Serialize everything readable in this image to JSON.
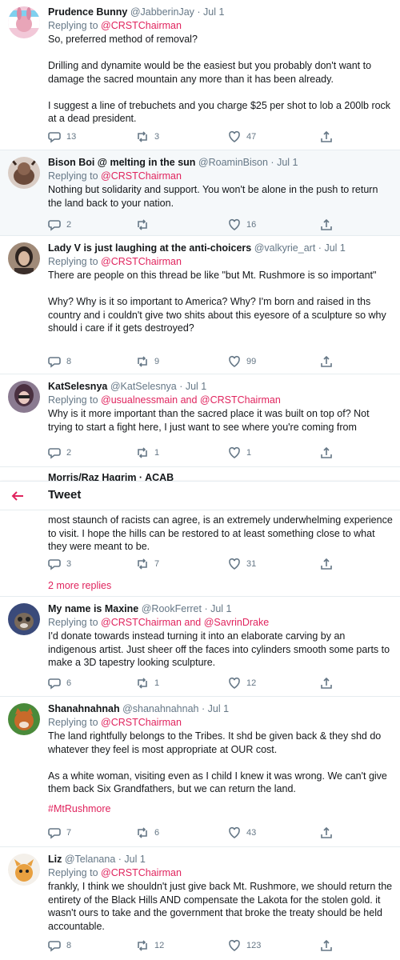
{
  "colors": {
    "accent": "#e0245e",
    "secondary_text": "#657786",
    "divider": "#e6ecf0"
  },
  "tweets": [
    {
      "name": "Prudence Bunny",
      "handle": "@JabberinJay",
      "dot": "·",
      "date": "Jul 1",
      "replying_prefix": "Replying to",
      "mentions": "@CRSTChairman",
      "text": "So, preferred method of removal?\n\nDrilling and dynamite would be the easiest but you probably don't want to damage the sacred mountain any more than it has been already.\n\nI suggest a line of trebuchets and you charge $25 per shot to lob a 200lb rock at a dead president.",
      "replies": "13",
      "retweets": "3",
      "likes": "47"
    },
    {
      "name": "Bison Boi @ melting in the sun",
      "handle": "@RoaminBison",
      "dot": "·",
      "date": "Jul 1",
      "replying_prefix": "Replying to",
      "mentions": "@CRSTChairman",
      "text": "Nothing but solidarity and support. You won't be alone in the push to return the land back to your nation.",
      "replies": "2",
      "retweets": "",
      "likes": "16"
    },
    {
      "name": "Lady V is just laughing at the anti-choicers",
      "handle": "@valkyrie_art",
      "dot": "·",
      "date": "Jul 1",
      "replying_prefix": "Replying to",
      "mentions": "@CRSTChairman",
      "text": "There are people on this thread be like \"but Mt. Rushmore is so important\"\n\nWhy? Why is it so important to America? Why?  I'm born and raised in ths country and i couldn't give two shits about this eyesore of a sculpture so why should i care if it gets destroyed?",
      "replies": "8",
      "retweets": "9",
      "likes": "99"
    },
    {
      "name": "KatSelesnya",
      "handle": "@KatSelesnya",
      "dot": "·",
      "date": "Jul 1",
      "replying_prefix": "Replying to",
      "mentions": "@usualnessmain and @CRSTChairman",
      "text": "Why is it more important than the sacred place it was built on top of? Not trying to start a fight here, I just want to see where you're coming from",
      "replies": "2",
      "retweets": "1",
      "likes": "1"
    },
    {
      "text": "most staunch of racists can agree, is an extremely underwhelming experience to visit. I hope the hills can be restored to at least something close to what they were meant to be.",
      "replies": "3",
      "retweets": "7",
      "likes": "31",
      "more_replies": "2 more replies"
    },
    {
      "name": "My name is Maxine",
      "handle": "@RookFerret",
      "dot": "·",
      "date": "Jul 1",
      "replying_prefix": "Replying to",
      "mentions": "@CRSTChairman and @SavrinDrake",
      "text": "I'd donate towards instead turning it into an elaborate carving by an indigenous artist. Just sheer off the faces into cylinders smooth some parts to make a 3D tapestry looking sculpture.",
      "replies": "6",
      "retweets": "1",
      "likes": "12"
    },
    {
      "name": "Shanahnahnah",
      "handle": "@shanahnahnah",
      "dot": "·",
      "date": "Jul 1",
      "replying_prefix": "Replying to",
      "mentions": "@CRSTChairman",
      "text": "The land rightfully belongs to the Tribes. It shd be given back & they shd do whatever they feel is most appropriate at OUR cost.\n\nAs a white woman, visiting even as I child I knew it was wrong. We can't give them back Six Grandfathers, but we can return the land.",
      "hashtag": "#MtRushmore",
      "replies": "7",
      "retweets": "6",
      "likes": "43"
    },
    {
      "name": "Liz",
      "handle": "@Telanana",
      "dot": "·",
      "date": "Jul 1",
      "replying_prefix": "Replying to",
      "mentions": "@CRSTChairman",
      "text": "frankly, I think we shouldn't just give back Mt. Rushmore, we should return the entirety of the Black Hills AND compensate the Lakota for the stolen gold. it wasn't ours to take and the government that broke the treaty should be held accountable.",
      "replies": "8",
      "retweets": "12",
      "likes": "123"
    }
  ],
  "peek_name": "Morris/Raz  Hagrim  ·  ACAB",
  "topbar": {
    "title": "Tweet",
    "back_icon": "back-arrow-icon"
  }
}
